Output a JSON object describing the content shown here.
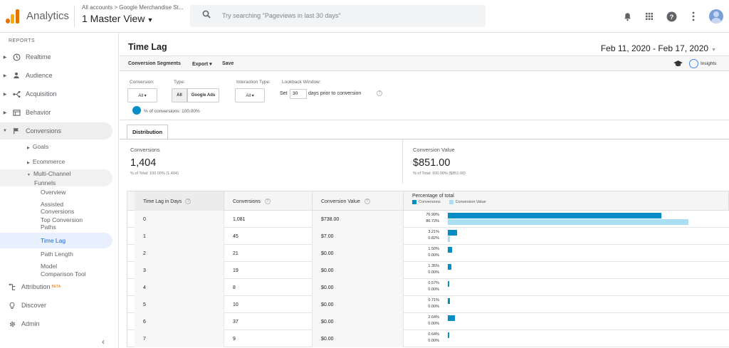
{
  "header": {
    "app_name": "Analytics",
    "breadcrumb": "All accounts > Google Merchandise St...",
    "view_name": "1 Master View",
    "search_placeholder": "Try searching \"Pageviews in last 30 days\""
  },
  "sidebar": {
    "section_label": "REPORTS",
    "items": [
      {
        "label": "Realtime",
        "icon": "clock-icon"
      },
      {
        "label": "Audience",
        "icon": "person-icon"
      },
      {
        "label": "Acquisition",
        "icon": "acquisition-icon"
      },
      {
        "label": "Behavior",
        "icon": "behavior-icon"
      },
      {
        "label": "Conversions",
        "icon": "flag-icon"
      }
    ],
    "subitems": {
      "goals": "Goals",
      "ecommerce": "Ecommerce",
      "multichannel_1": "Multi-Channel",
      "multichannel_2": "Funnels",
      "overview": "Overview",
      "assisted_1": "Assisted",
      "assisted_2": "Conversions",
      "top_1": "Top Conversion",
      "top_2": "Paths",
      "time_lag": "Time Lag",
      "path_length": "Path Length",
      "model_1": "Model",
      "model_2": "Comparison Tool"
    },
    "bottom": {
      "attribution": "Attribution",
      "beta": "BETA",
      "discover": "Discover",
      "admin": "Admin"
    }
  },
  "page": {
    "title": "Time Lag",
    "date_range": "Feb 11, 2020 - Feb 17, 2020"
  },
  "toolbar": {
    "conversion_segments": "Conversion Segments",
    "export": "Export ▾",
    "save": "Save",
    "insights": "Insights"
  },
  "filters": {
    "conversion_label": "Conversion:",
    "conversion_value": "All ▾",
    "type_label": "Type:",
    "type_all": "All",
    "type_google_ads": "Google Ads",
    "interaction_label": "Interaction Type:",
    "interaction_value": "All ▾",
    "lookback_label": "Lookback Window:",
    "set_text": "Set",
    "days_value": "30",
    "days_suffix": "days prior to conversion",
    "legend": "% of conversions: 100.00%"
  },
  "tabs": {
    "distribution": "Distribution"
  },
  "summary": {
    "conv_label": "Conversions",
    "conv_value": "1,404",
    "conv_sub": "% of Total: 100.00% (1,404)",
    "val_label": "Conversion Value",
    "val_value": "$851.00",
    "val_sub": "% of Total: 100.00% ($851.00)"
  },
  "table": {
    "headers": {
      "lag": "Time Lag in Days",
      "conversions": "Conversions",
      "value": "Conversion Value",
      "pct": "Percentage of total",
      "legend_conv": "Conversions",
      "legend_val": "Conversion Value"
    },
    "rows": [
      {
        "lag": "0",
        "conversions": "1,081",
        "value": "$738.00",
        "pct_conv": "76.99%",
        "pct_val": "86.72%",
        "conv_frac": 0.7699,
        "val_frac": 0.8672
      },
      {
        "lag": "1",
        "conversions": "45",
        "value": "$7.00",
        "pct_conv": "3.21%",
        "pct_val": "0.82%",
        "conv_frac": 0.0321,
        "val_frac": 0.0082
      },
      {
        "lag": "2",
        "conversions": "21",
        "value": "$0.00",
        "pct_conv": "1.50%",
        "pct_val": "0.00%",
        "conv_frac": 0.015,
        "val_frac": 0
      },
      {
        "lag": "3",
        "conversions": "19",
        "value": "$0.00",
        "pct_conv": "1.35%",
        "pct_val": "0.00%",
        "conv_frac": 0.0135,
        "val_frac": 0
      },
      {
        "lag": "4",
        "conversions": "8",
        "value": "$0.00",
        "pct_conv": "0.57%",
        "pct_val": "0.00%",
        "conv_frac": 0.0057,
        "val_frac": 0
      },
      {
        "lag": "5",
        "conversions": "10",
        "value": "$0.00",
        "pct_conv": "0.71%",
        "pct_val": "0.00%",
        "conv_frac": 0.0071,
        "val_frac": 0
      },
      {
        "lag": "6",
        "conversions": "37",
        "value": "$0.00",
        "pct_conv": "2.64%",
        "pct_val": "0.00%",
        "conv_frac": 0.0264,
        "val_frac": 0
      },
      {
        "lag": "7",
        "conversions": "9",
        "value": "$0.00",
        "pct_conv": "0.64%",
        "pct_val": "0.00%",
        "conv_frac": 0.0064,
        "val_frac": 0
      }
    ]
  },
  "colors": {
    "conv_bar": "#058dc7",
    "val_bar": "#aadff3",
    "accent": "#1967d2",
    "logo_orange": "#f9ab00",
    "logo_dark": "#e37400"
  }
}
